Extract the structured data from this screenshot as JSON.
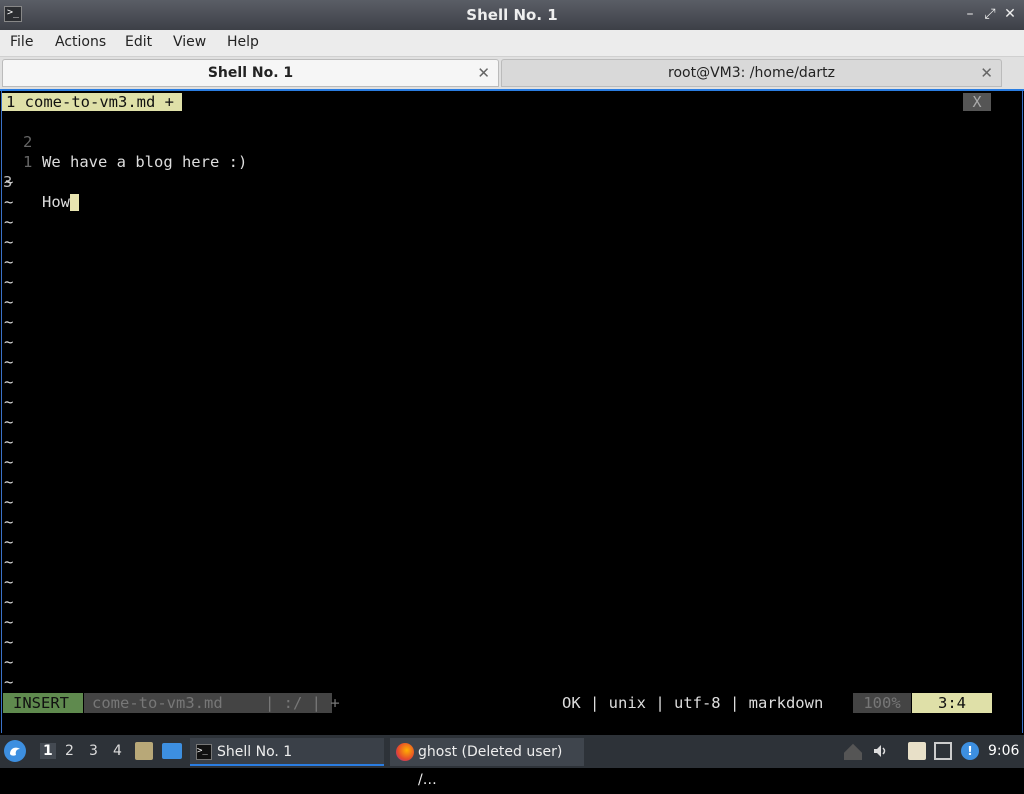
{
  "window": {
    "title": "Shell No. 1",
    "controls": {
      "minimize": "–",
      "restore": "⤢",
      "close": "✕"
    }
  },
  "menu": [
    "File",
    "Actions",
    "Edit",
    "View",
    "Help"
  ],
  "tabs": [
    {
      "label": "Shell No. 1",
      "active": true
    },
    {
      "label": "root@VM3: /home/dartz",
      "active": false
    }
  ],
  "editor": {
    "buffer_tab": "1 come-to-vm3.md +",
    "close_label": "X",
    "lines": [
      {
        "number": "2",
        "text": "We have a blog here :)"
      },
      {
        "number": "1",
        "text": ""
      },
      {
        "number": "3",
        "text": "How"
      }
    ],
    "tilde": "~",
    "tilde_count": 26
  },
  "statusline": {
    "mode": "INSERT",
    "file": "come-to-vm3.md",
    "file_extra": "| :/ | +",
    "format": "OK | unix | utf-8 | markdown",
    "percent": "100%",
    "position": "3:4"
  },
  "taskbar": {
    "workspaces": [
      "1",
      "2",
      "3",
      "4"
    ],
    "active_workspace": "1",
    "tasks": [
      {
        "label": "Shell No. 1",
        "icon": "terminal-icon",
        "active": true
      },
      {
        "label": "ghost (Deleted user) /…",
        "icon": "firefox-icon",
        "active": false
      }
    ],
    "clock": "9:06"
  },
  "colors": {
    "accent": "#2a7de1",
    "insert_mode": "#5f8a4e",
    "highlight": "#dfe0a8"
  }
}
